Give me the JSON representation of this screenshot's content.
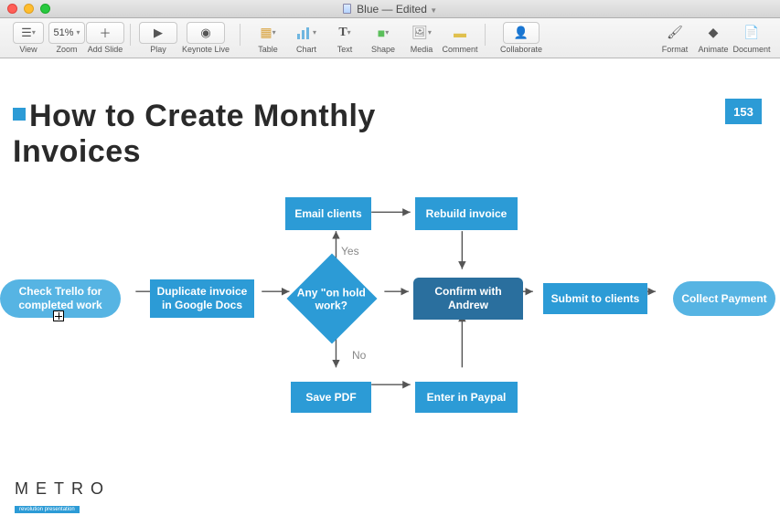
{
  "window": {
    "doc_name": "Blue",
    "status": "Edited"
  },
  "toolbar": {
    "view": "View",
    "zoom_label": "Zoom",
    "zoom_value": "51%",
    "add_slide": "Add Slide",
    "play": "Play",
    "keynote_live": "Keynote Live",
    "table": "Table",
    "chart": "Chart",
    "text": "Text",
    "shape": "Shape",
    "media": "Media",
    "comment": "Comment",
    "collaborate": "Collaborate",
    "format": "Format",
    "animate": "Animate",
    "document": "Document"
  },
  "slide": {
    "title_line1": "How to Create Monthly",
    "title_line2": "Invoices",
    "number": "153"
  },
  "flow": {
    "check_trello": "Check Trello for completed work",
    "duplicate_invoice": "Duplicate invoice in Google Docs",
    "any_on_hold": "Any \"on hold work?",
    "email_clients": "Email clients",
    "rebuild_invoice": "Rebuild invoice",
    "confirm_andrew": "Confirm with Andrew",
    "save_pdf": "Save PDF",
    "enter_paypal": "Enter in Paypal",
    "submit_clients": "Submit to clients",
    "collect_payment": "Collect Payment",
    "yes": "Yes",
    "no": "No"
  },
  "logo": {
    "main": "METRO",
    "sub": "revolution presentation"
  }
}
